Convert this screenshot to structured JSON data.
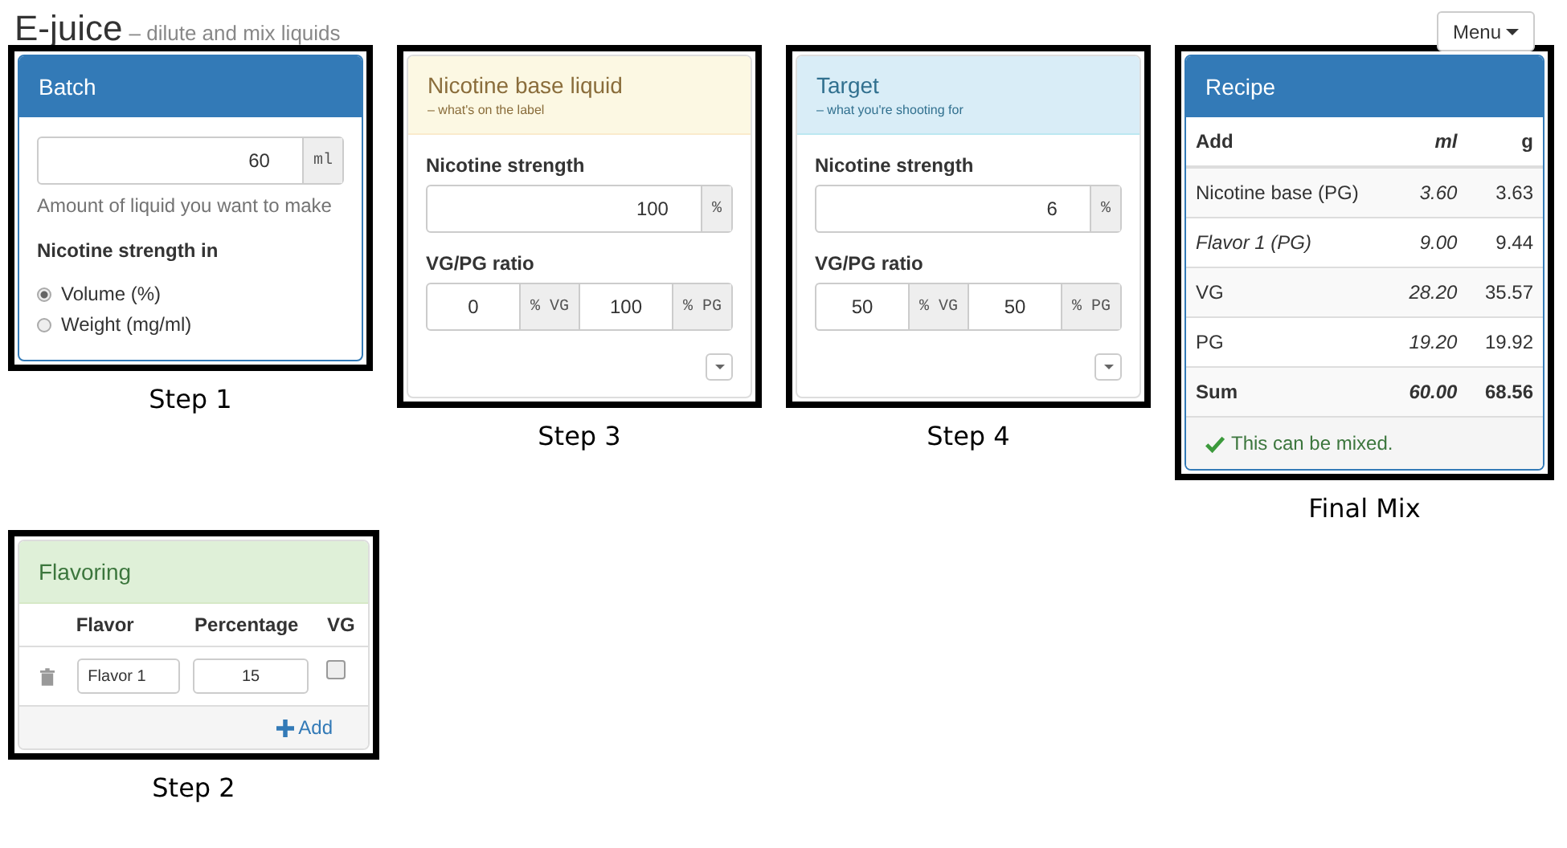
{
  "header": {
    "title": "E-juice",
    "subtitle": "– dilute and mix liquids"
  },
  "menu_button": {
    "label": "Menu"
  },
  "batch": {
    "caption": "Step 1",
    "title": "Batch",
    "amount": {
      "value": "60",
      "unit": "ml"
    },
    "help": "Amount of liquid you want to make",
    "strength_label": "Nicotine strength in",
    "options": [
      {
        "label": "Volume (%)",
        "selected": true
      },
      {
        "label": "Weight (mg/ml)",
        "selected": false
      }
    ]
  },
  "base": {
    "caption": "Step 3",
    "title": "Nicotine base liquid",
    "subtitle": "– what's on the label",
    "strength_label": "Nicotine strength",
    "strength": {
      "value": "100",
      "unit": "%"
    },
    "ratio_label": "VG/PG ratio",
    "vg": {
      "value": "0",
      "unit": "% VG"
    },
    "pg": {
      "value": "100",
      "unit": "% PG"
    }
  },
  "target": {
    "caption": "Step 4",
    "title": "Target",
    "subtitle": "– what you're shooting for",
    "strength_label": "Nicotine strength",
    "strength": {
      "value": "6",
      "unit": "%"
    },
    "ratio_label": "VG/PG ratio",
    "vg": {
      "value": "50",
      "unit": "% VG"
    },
    "pg": {
      "value": "50",
      "unit": "% PG"
    }
  },
  "recipe": {
    "caption": "Final Mix",
    "title": "Recipe",
    "columns": [
      "Add",
      "ml",
      "g"
    ],
    "rows": [
      {
        "kind": "item",
        "name": "Nicotine base (PG)",
        "ml": "3.60",
        "g": "3.63"
      },
      {
        "kind": "flavor",
        "name": "Flavor 1 (PG)",
        "ml": "9.00",
        "g": "9.44"
      },
      {
        "kind": "item",
        "name": "VG",
        "ml": "28.20",
        "g": "35.57"
      },
      {
        "kind": "item",
        "name": "PG",
        "ml": "19.20",
        "g": "19.92"
      },
      {
        "kind": "total",
        "name": "Sum",
        "ml": "60.00",
        "g": "68.56"
      }
    ],
    "status": "This can be mixed."
  },
  "flavoring": {
    "caption": "Step 2",
    "title": "Flavoring",
    "columns": [
      "Flavor",
      "Percentage",
      "VG"
    ],
    "rows": [
      {
        "name": "Flavor 1",
        "percentage": "15",
        "vg": false
      }
    ],
    "add_label": "Add"
  }
}
